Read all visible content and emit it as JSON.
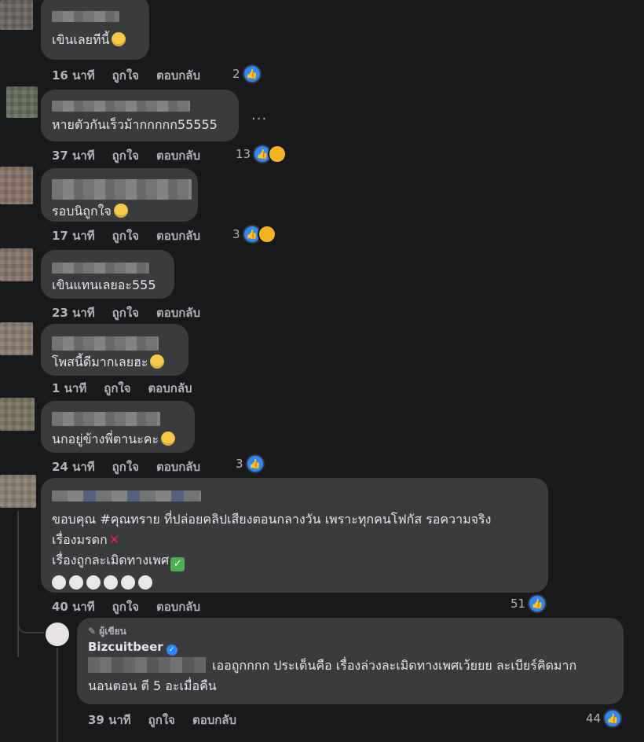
{
  "actions": {
    "like": "ถูกใจ",
    "reply": "ตอบกลับ"
  },
  "comments": [
    {
      "time": "16 นาที",
      "text": "เขินเลยทีนี้",
      "count": "2"
    },
    {
      "time": "37 นาที",
      "text": "หายตัวกันเร็วม้ากกกกก55555",
      "count": "13",
      "more": "..."
    },
    {
      "time": "17 นาที",
      "text": "รอบนิถูกใจ",
      "count": "3"
    },
    {
      "time": "23 นาที",
      "text": "เขินแทนเลยอะ555",
      "count": ""
    },
    {
      "time": "1 นาที",
      "text": "โพสนี้ดีมากเลยฮะ",
      "count": ""
    },
    {
      "time": "24 นาที",
      "text": "นกอยู่ข้างพี่ตานะคะ",
      "count": "3"
    },
    {
      "time": "40 นาที",
      "lines": [
        "ขอบคุณ #คุณทราย ที่ปล่อยคลิปเสียงตอนกลางวัน เพราะทุกคนโฟกัส รอความจริง",
        "เรื่องมรดก",
        "เรื่องถูกละเมิดทางเพศ"
      ],
      "count": "51"
    }
  ],
  "reply": {
    "badge": "ผู้เขียน",
    "name": "Bizcuitbeer",
    "line1": "เออถูกกกก ประเด็นคือ เรื่องล่วงละเมิดทางเพศเว้ยยย ละเบียร์คิดมาก",
    "line2": "นอนตอน ตี 5 อะเมื่อคืน",
    "time": "39 นาที",
    "count": "44"
  },
  "icons": {
    "like": "thumbs-up-icon",
    "cross": "cross-mark-icon",
    "check": "check-mark-icon"
  },
  "colors": {
    "background": "#18191a",
    "bubble": "#3a3b3c",
    "like": "#2d88ff"
  }
}
